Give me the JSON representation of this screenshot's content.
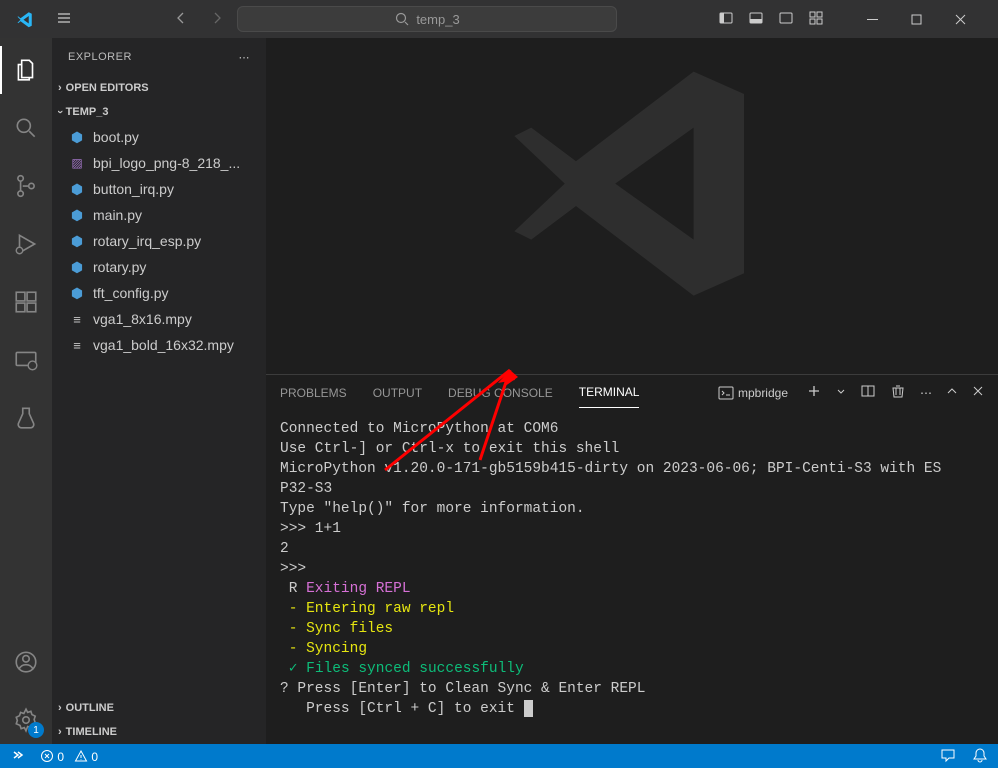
{
  "titlebar": {
    "search_placeholder": "temp_3"
  },
  "sidebar": {
    "title": "EXPLORER",
    "sections": {
      "open_editors": "OPEN EDITORS",
      "folder": "TEMP_3",
      "outline": "OUTLINE",
      "timeline": "TIMELINE"
    },
    "files": [
      {
        "name": "boot.py",
        "icon": "py"
      },
      {
        "name": "bpi_logo_png-8_218_...",
        "icon": "img"
      },
      {
        "name": "button_irq.py",
        "icon": "py"
      },
      {
        "name": "main.py",
        "icon": "py"
      },
      {
        "name": "rotary_irq_esp.py",
        "icon": "py"
      },
      {
        "name": "rotary.py",
        "icon": "py"
      },
      {
        "name": "tft_config.py",
        "icon": "py"
      },
      {
        "name": "vga1_8x16.mpy",
        "icon": "mpy"
      },
      {
        "name": "vga1_bold_16x32.mpy",
        "icon": "mpy"
      }
    ]
  },
  "panel": {
    "tabs": {
      "problems": "PROBLEMS",
      "output": "OUTPUT",
      "debug": "DEBUG CONSOLE",
      "terminal": "TERMINAL"
    },
    "terminal_name": "mpbridge"
  },
  "terminal": {
    "l1": "Connected to MicroPython at COM6",
    "l2": "Use Ctrl-] or Ctrl-x to exit this shell",
    "l3": "MicroPython v1.20.0-171-gb5159b415-dirty on 2023-06-06; BPI-Centi-S3 with ES",
    "l4": "P32-S3",
    "l5": "Type \"help()\" for more information.",
    "l6": ">>> 1+1",
    "l7": "2",
    "l8": ">>>",
    "l9a": " R ",
    "l9b": "Exiting REPL",
    "l10": " - Entering raw repl",
    "l11": " - Sync files",
    "l12": " - Syncing",
    "l13a": " ✓ ",
    "l13b": "Files synced successfully",
    "l14": "? Press [Enter] to Clean Sync & Enter REPL",
    "l15": "   Press [Ctrl + C] to exit "
  },
  "statusbar": {
    "errors": "0",
    "warnings": "0"
  },
  "activity_badge": "1"
}
